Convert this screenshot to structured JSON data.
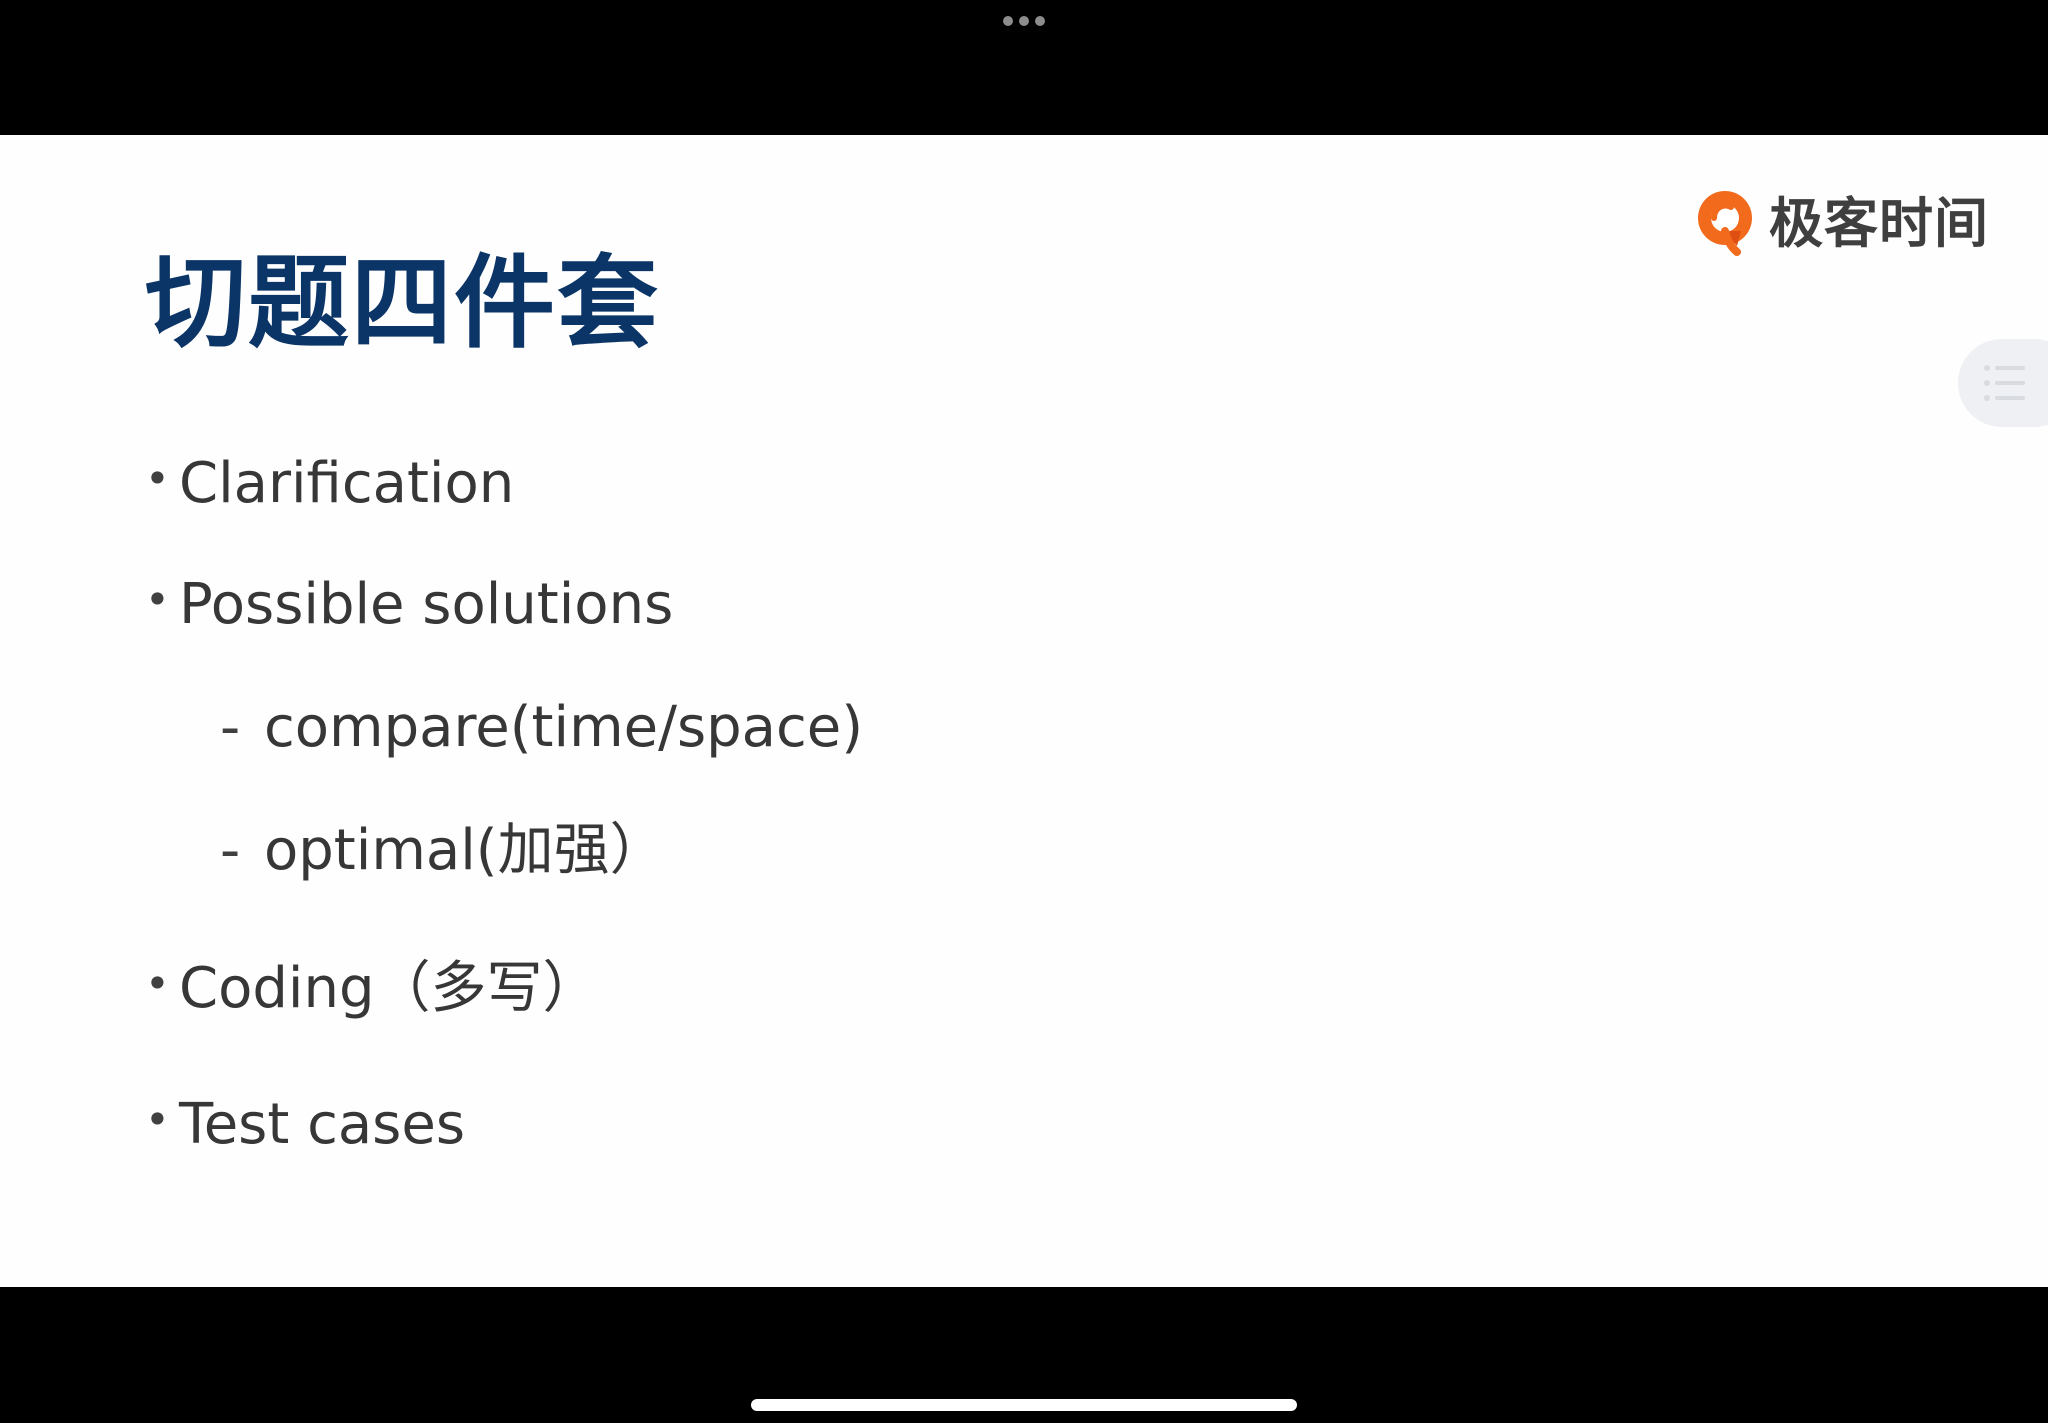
{
  "screen": {
    "top_bar": {
      "dots_icon": "ellipsis-icon"
    },
    "slide": {
      "title": "切题四件套",
      "brand": {
        "icon": "geektime-logo-icon",
        "name": "极客时间",
        "colors": {
          "orange": "#f26b1d",
          "dark_orange": "#df4f12",
          "text": "#3f3f3f"
        }
      },
      "side_tab": {
        "icon": "list-icon"
      },
      "bullets": [
        {
          "marker": "•",
          "text": "Clarification"
        },
        {
          "marker": "•",
          "text": "Possible solutions"
        },
        {
          "marker": "•",
          "text": "Coding（多写）"
        },
        {
          "marker": "•",
          "text": "Test cases"
        }
      ],
      "sub_items": [
        {
          "marker": "-",
          "text": "compare(time/space)"
        },
        {
          "marker": "-",
          "text": "optimal(加强）"
        }
      ]
    },
    "bottom_bar": {
      "home_indicator": "home-indicator"
    },
    "colors": {
      "title": "#0c3567",
      "body_text": "#373737",
      "slide_background": "#fefefe",
      "letterbox": "#000000"
    }
  }
}
